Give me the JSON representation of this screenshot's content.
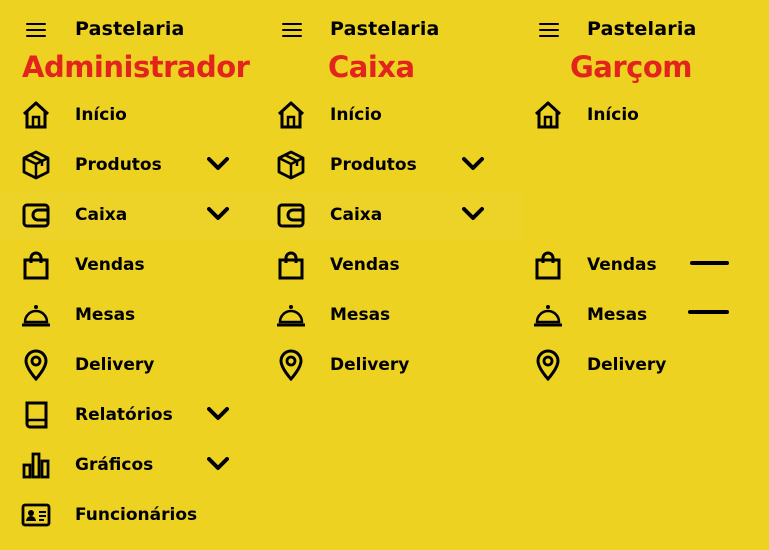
{
  "app_title": "Pastelaria",
  "columns": [
    {
      "role": "Administrador",
      "items": [
        {
          "label": "Início",
          "icon": "home-icon"
        },
        {
          "label": "Produtos",
          "icon": "box-icon",
          "expand": true
        },
        {
          "label": "Caixa",
          "icon": "wallet-icon",
          "expand": true
        },
        {
          "label": "Vendas",
          "icon": "shopping-bag-icon"
        },
        {
          "label": "Mesas",
          "icon": "service-bell-icon"
        },
        {
          "label": "Delivery",
          "icon": "location-pin-icon"
        },
        {
          "label": "Relatórios",
          "icon": "book-icon",
          "expand": true
        },
        {
          "label": "Gráficos",
          "icon": "bar-chart-icon",
          "expand": true
        },
        {
          "label": "Funcionários",
          "icon": "id-card-icon"
        }
      ]
    },
    {
      "role": "Caixa",
      "items": [
        {
          "label": "Início",
          "icon": "home-icon"
        },
        {
          "label": "Produtos",
          "icon": "box-icon",
          "expand": true
        },
        {
          "label": "Caixa",
          "icon": "wallet-icon",
          "expand": true
        },
        {
          "label": "Vendas",
          "icon": "shopping-bag-icon"
        },
        {
          "label": "Mesas",
          "icon": "service-bell-icon"
        },
        {
          "label": "Delivery",
          "icon": "location-pin-icon"
        }
      ]
    },
    {
      "role": "Garçom",
      "items": [
        {
          "label": "Início",
          "icon": "home-icon"
        },
        {
          "label": "Vendas",
          "icon": "shopping-bag-icon"
        },
        {
          "label": "Mesas",
          "icon": "service-bell-icon"
        },
        {
          "label": "Delivery",
          "icon": "location-pin-icon"
        }
      ]
    }
  ],
  "colors": {
    "background": "#EDD222",
    "role_title": "#E2241D",
    "text": "#000000"
  }
}
